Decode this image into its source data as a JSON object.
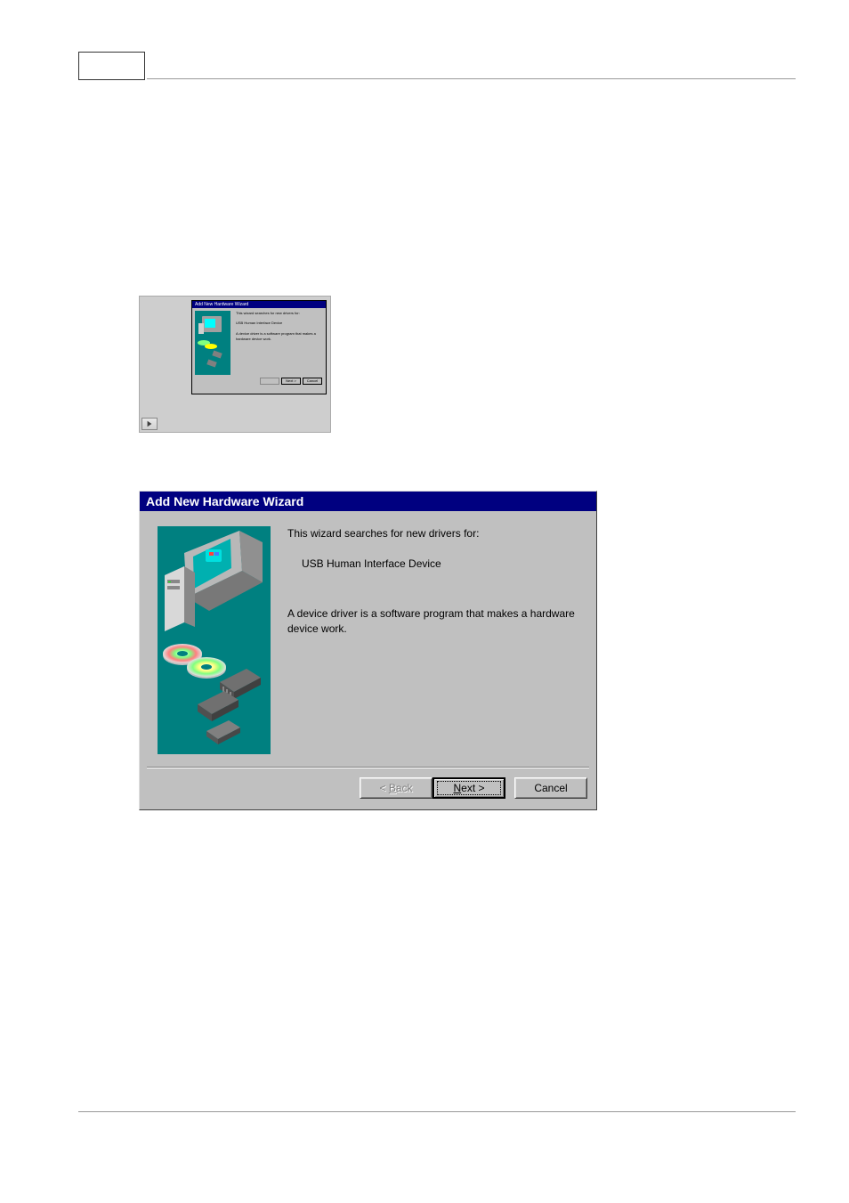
{
  "thumbnail": {
    "title": "Add New Hardware Wizard",
    "line1": "This wizard searches for new drivers for:",
    "line2": "USB Human Interface Device",
    "line3": "A device driver is a software program that makes a hardware device work.",
    "back_label": "< Back",
    "next_label": "Next >",
    "cancel_label": "Cancel"
  },
  "wizard": {
    "title": "Add New Hardware Wizard",
    "intro": "This wizard searches for new drivers for:",
    "device": "USB Human Interface Device",
    "description": "A device driver is a software program that makes a hardware device work.",
    "back_prefix": "< ",
    "back_char": "B",
    "back_suffix": "ack",
    "next_prefix": "",
    "next_char": "N",
    "next_suffix": "ext >",
    "cancel_label": "Cancel"
  }
}
